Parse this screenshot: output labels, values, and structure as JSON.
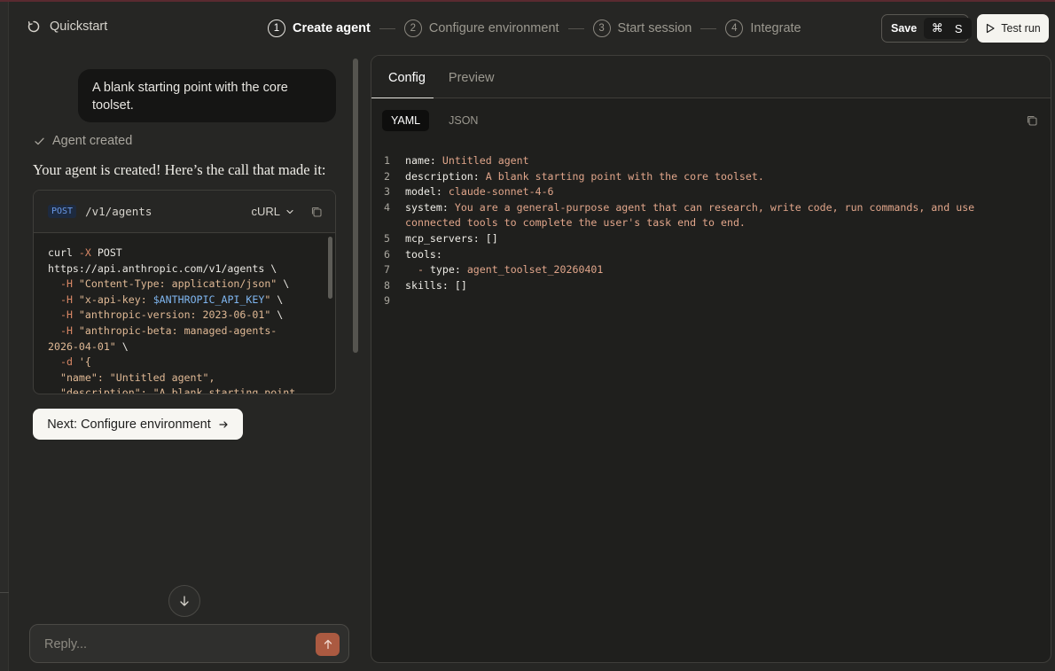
{
  "header": {
    "brand": "Quickstart",
    "steps": [
      {
        "num": "1",
        "label": "Create agent"
      },
      {
        "num": "2",
        "label": "Configure environment"
      },
      {
        "num": "3",
        "label": "Start session"
      },
      {
        "num": "4",
        "label": "Integrate"
      }
    ],
    "active_step": 0,
    "save_label": "Save",
    "save_keys": [
      "⌘",
      "S"
    ],
    "test_label": "Test run"
  },
  "chat": {
    "user_message": "A blank starting point with the core toolset.",
    "status": "Agent created",
    "message": "Your agent is created! Here’s the call that made it:",
    "code": {
      "method": "POST",
      "path": "/v1/agents",
      "language": "cURL"
    },
    "next_label": "Next: Configure environment",
    "reply_placeholder": "Reply..."
  },
  "config": {
    "tabs": [
      "Config",
      "Preview"
    ],
    "formats": [
      "YAML",
      "JSON"
    ],
    "yaml": {
      "name": "Untitled agent",
      "description": "A blank starting point with the core toolset.",
      "model": "claude-sonnet-4-6",
      "system_1": "You are a general-purpose agent that can research, write code, run commands, and use",
      "system_2": "connected tools to complete the user's task end to end.",
      "mcp_servers": "[]",
      "tool_type": "agent_toolset_20260401",
      "skills": "[]"
    }
  },
  "colors": {
    "background": "#262624",
    "accent_send": "#ab5a41",
    "yaml_value": "#e0a58a",
    "method_blue": "#6b9ae8"
  }
}
